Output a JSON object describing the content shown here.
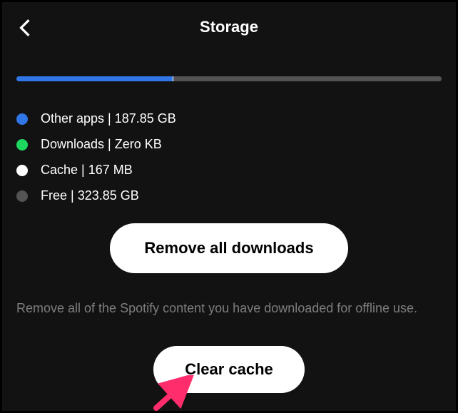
{
  "header": {
    "title": "Storage"
  },
  "storage_bar": {
    "segments": [
      {
        "key": "other_apps",
        "percent": 36.7,
        "color": "blue"
      },
      {
        "key": "downloads",
        "percent": 0,
        "color": "green"
      },
      {
        "key": "cache",
        "percent": 0.2,
        "color": "white"
      },
      {
        "key": "free",
        "percent": 63.1,
        "color": "gray"
      }
    ]
  },
  "legend": {
    "items": [
      {
        "color": "blue",
        "label": "Other apps | 187.85 GB"
      },
      {
        "color": "green",
        "label": "Downloads | Zero KB"
      },
      {
        "color": "white",
        "label": "Cache | 167 MB"
      },
      {
        "color": "gray",
        "label": "Free | 323.85 GB"
      }
    ]
  },
  "buttons": {
    "remove_downloads": "Remove all downloads",
    "clear_cache": "Clear cache"
  },
  "descriptions": {
    "remove_downloads": "Remove all of the Spotify content you have downloaded for offline use."
  },
  "colors": {
    "blue": "#3076e6",
    "green": "#1ed760",
    "white": "#ffffff",
    "gray": "#535353",
    "accent_arrow": "#ff2d6b"
  }
}
